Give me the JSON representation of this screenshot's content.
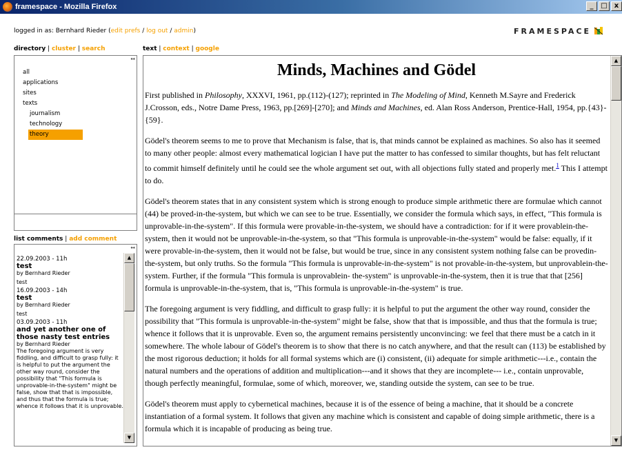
{
  "window": {
    "title": "framespace - Mozilla Firefox",
    "buttons": [
      "_",
      "□",
      "x"
    ]
  },
  "header": {
    "logged_in_prefix": "logged in as: Bernhard Rieder (",
    "links": [
      "edit prefs",
      "log out",
      "admin"
    ],
    "sep": " / ",
    "suffix": ")",
    "logo": "FRAMESPACE",
    "logo_icon": "framespace-logo-icon"
  },
  "left_tabs": [
    {
      "label": "directory",
      "active": true
    },
    {
      "label": "cluster",
      "active": false
    },
    {
      "label": "search",
      "active": false
    }
  ],
  "main_tabs": [
    {
      "label": "text",
      "active": true
    },
    {
      "label": "context",
      "active": false
    },
    {
      "label": "google",
      "active": false
    }
  ],
  "directory": {
    "items": [
      {
        "label": "all",
        "level": 1
      },
      {
        "label": "applications",
        "level": 2
      },
      {
        "label": "sites",
        "level": 2
      },
      {
        "label": "texts",
        "level": 2
      },
      {
        "label": "journalism",
        "level": 3
      },
      {
        "label": "technology",
        "level": 3
      },
      {
        "label": "theory",
        "level": 3,
        "selected": true
      }
    ]
  },
  "comment_tabs": [
    {
      "label": "list comments",
      "active": true
    },
    {
      "label": "add comment",
      "active": false
    }
  ],
  "comments": [
    {
      "date": "22.09.2003 - 11h",
      "title": "test",
      "by": "by Bernhard Rieder",
      "body": "test"
    },
    {
      "date": "16.09.2003 - 14h",
      "title": "test",
      "by": "by Bernhard Rieder",
      "body": "test"
    },
    {
      "date": "03.09.2003 - 11h",
      "title": "and yet another one of those nasty test entries",
      "by": "by Bernhard Rieder",
      "body": "The foregoing argument is very fiddling, and difficult to grasp fully: it is helpful to put the argument the other way round, consider the possibility that \"This formula is unprovable-in-the-system\" might be false, show that that is impossible, and thus that the formula is true; whence it follows that it is unprovable."
    }
  ],
  "article": {
    "title": "Minds, Machines and Gödel",
    "pub_1": "First published in ",
    "pub_philosophy": "Philosophy",
    "pub_2": ", XXXVI, 1961, pp.(112)-(127); reprinted in ",
    "pub_modeling": "The Modeling of Mind",
    "pub_3": ", Kenneth M.Sayre and Frederick J.Crosson, eds., Notre Dame Press, 1963, pp.[269]-[270]; and ",
    "pub_minds": "Minds and Machines",
    "pub_4": ", ed. Alan Ross Anderson, Prentice-Hall, 1954, pp.{43}-{59}.",
    "p1": "Gödel's theorem seems to me to prove that Mechanism is false, that is, that minds cannot be explained as machines. So also has it seemed to many other people: almost every mathematical logician I have put the matter to has confessed to similar thoughts, but has felt reluctant to commit himself definitely until he could see the whole argument set out, with all objections fully stated and properly met.",
    "footnote": "1",
    "p1_end": " This I attempt to do.",
    "p2": "Gödel's theorem states that in any consistent system which is strong enough to produce simple arithmetic there are formulae which cannot (44) be proved-in-the-system, but which we can see to be true. Essentially, we consider the formula which says, in effect, \"This formula is unprovable-in-the-system\". If this formula were provable-in-the-system, we should have a contradiction: for if it were provablein-the-system, then it would not be unprovable-in-the-system, so that \"This formula is unprovable-in-the-system\" would be false: equally, if it were provable-in-the-system, then it would not be false, but would be true, since in any consistent system nothing false can be provedin-the-system, but only truths. So the formula \"This formula is unprovable-in-the-system\" is not provable-in-the-system, but unprovablein-the-system. Further, if the formula \"This formula is unprovablein- the-system\" is unprovable-in-the-system, then it is true that that [256] formula is unprovable-in-the-system, that is, \"This formula is unprovable-in-the-system\" is true.",
    "p3": "The foregoing argument is very fiddling, and difficult to grasp fully: it is helpful to put the argument the other way round, consider the possibility that \"This formula is unprovable-in-the-system\" might be false, show that that is impossible, and thus that the formula is true; whence it follows that it is unprovable. Even so, the argument remains persistently unconvincing: we feel that there must be a catch in it somewhere. The whole labour of Gödel's theorem is to show that there is no catch anywhere, and that the result can (113) be established by the most rigorous deduction; it holds for all formal systems which are (i) consistent, (ii) adequate for simple arithmetic---i.e., contain the natural numbers and the operations of addition and multiplication---and it shows that they are incomplete--- i.e., contain unprovable, though perfectly meaningful, formulae, some of which, moreover, we, standing outside the system, can see to be true.",
    "p4": "Gödel's theorem must apply to cybernetical machines, because it is of the essence of being a machine, that it should be a concrete instantiation of a formal system. It follows that given any machine which is consistent and capable of doing simple arithmetic, there is a formula which it is incapable of producing as being true."
  },
  "colors": {
    "accent": "#f5a000",
    "titlebar_start": "#0a246a",
    "titlebar_end": "#a6caf0",
    "link": "#0000cc"
  }
}
